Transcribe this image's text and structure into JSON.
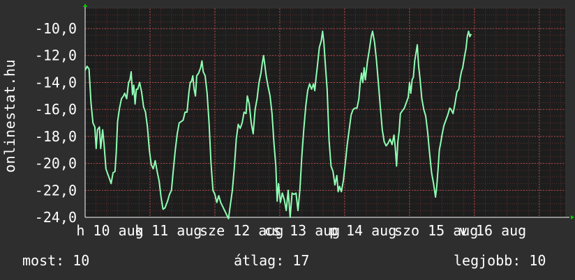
{
  "watermark": "onlinestat.hu",
  "stats": {
    "now_label": "most:",
    "now_value": "10",
    "avg_label": "átlag:",
    "avg_value": "17",
    "best_label": "legjobb:",
    "best_value": "10"
  },
  "colors": {
    "background": "#2e2e2e",
    "plot_background": "#1d1d1d",
    "line": "#8fffb4",
    "grid": "#b04a4a",
    "axis_arrow": "#00cc00",
    "text": "#ffffff"
  },
  "chart_data": {
    "type": "line",
    "title": "",
    "xlabel": "",
    "ylabel": "",
    "ylim": [
      -24,
      -8.5
    ],
    "xlim": [
      0,
      7.4
    ],
    "y_ticks": [
      -24,
      -22,
      -20,
      -18,
      -16,
      -14,
      -12,
      -10
    ],
    "y_tick_labels": [
      "-24,0",
      "-22,0",
      "-20,0",
      "-18,0",
      "-16,0",
      "-14,0",
      "-12,0",
      "-10,0"
    ],
    "x_tick_labels": [
      {
        "x": -0.05,
        "label": "h 10 aug"
      },
      {
        "x": 0.85,
        "label": "k 11 aug"
      },
      {
        "x": 1.85,
        "label": "sze 12 aug"
      },
      {
        "x": 2.85,
        "label": "cs 13 aug"
      },
      {
        "x": 3.85,
        "label": "p 14 aug"
      },
      {
        "x": 4.85,
        "label": "szo 15 aug"
      },
      {
        "x": 5.85,
        "label": "v 16 aug"
      }
    ],
    "grid": true,
    "series": [
      {
        "name": "",
        "points": [
          [
            0.0,
            -13.1
          ],
          [
            0.03,
            -12.8
          ],
          [
            0.06,
            -13.0
          ],
          [
            0.09,
            -15.5
          ],
          [
            0.12,
            -17.0
          ],
          [
            0.15,
            -17.3
          ],
          [
            0.17,
            -18.9
          ],
          [
            0.19,
            -17.5
          ],
          [
            0.22,
            -17.3
          ],
          [
            0.24,
            -18.9
          ],
          [
            0.27,
            -17.5
          ],
          [
            0.29,
            -18.5
          ],
          [
            0.32,
            -20.4
          ],
          [
            0.35,
            -20.8
          ],
          [
            0.38,
            -21.2
          ],
          [
            0.4,
            -21.5
          ],
          [
            0.43,
            -20.7
          ],
          [
            0.46,
            -20.6
          ],
          [
            0.48,
            -19.2
          ],
          [
            0.5,
            -16.9
          ],
          [
            0.53,
            -15.9
          ],
          [
            0.56,
            -15.2
          ],
          [
            0.59,
            -15.0
          ],
          [
            0.61,
            -14.8
          ],
          [
            0.64,
            -15.2
          ],
          [
            0.67,
            -14.0
          ],
          [
            0.69,
            -13.8
          ],
          [
            0.71,
            -13.2
          ],
          [
            0.73,
            -14.9
          ],
          [
            0.75,
            -14.2
          ],
          [
            0.77,
            -15.6
          ],
          [
            0.79,
            -14.5
          ],
          [
            0.81,
            -14.5
          ],
          [
            0.84,
            -14.0
          ],
          [
            0.87,
            -14.7
          ],
          [
            0.9,
            -15.8
          ],
          [
            0.93,
            -16.2
          ],
          [
            0.96,
            -17.3
          ],
          [
            0.99,
            -19.0
          ],
          [
            1.02,
            -20.1
          ],
          [
            1.05,
            -20.4
          ],
          [
            1.08,
            -19.8
          ],
          [
            1.11,
            -20.6
          ],
          [
            1.14,
            -21.3
          ],
          [
            1.17,
            -22.5
          ],
          [
            1.2,
            -23.4
          ],
          [
            1.23,
            -23.3
          ],
          [
            1.27,
            -22.8
          ],
          [
            1.3,
            -22.3
          ],
          [
            1.33,
            -22.0
          ],
          [
            1.36,
            -20.5
          ],
          [
            1.39,
            -19.0
          ],
          [
            1.42,
            -17.8
          ],
          [
            1.45,
            -17.0
          ],
          [
            1.48,
            -16.9
          ],
          [
            1.51,
            -16.8
          ],
          [
            1.54,
            -16.2
          ],
          [
            1.57,
            -16.2
          ],
          [
            1.6,
            -14.7
          ],
          [
            1.62,
            -14.0
          ],
          [
            1.64,
            -13.9
          ],
          [
            1.66,
            -13.5
          ],
          [
            1.68,
            -14.5
          ],
          [
            1.7,
            -15.0
          ],
          [
            1.72,
            -13.5
          ],
          [
            1.75,
            -13.3
          ],
          [
            1.78,
            -12.9
          ],
          [
            1.8,
            -12.4
          ],
          [
            1.82,
            -13.2
          ],
          [
            1.85,
            -13.5
          ],
          [
            1.88,
            -14.8
          ],
          [
            1.91,
            -17.0
          ],
          [
            1.94,
            -20.0
          ],
          [
            1.97,
            -22.0
          ],
          [
            2.0,
            -22.3
          ],
          [
            2.03,
            -22.9
          ],
          [
            2.06,
            -22.4
          ],
          [
            2.09,
            -22.9
          ],
          [
            2.12,
            -23.2
          ],
          [
            2.15,
            -23.5
          ],
          [
            2.18,
            -23.8
          ],
          [
            2.21,
            -24.1
          ],
          [
            2.24,
            -23.0
          ],
          [
            2.27,
            -22.0
          ],
          [
            2.3,
            -20.3
          ],
          [
            2.33,
            -18.2
          ],
          [
            2.36,
            -17.1
          ],
          [
            2.39,
            -17.4
          ],
          [
            2.42,
            -17.0
          ],
          [
            2.45,
            -16.2
          ],
          [
            2.48,
            -16.3
          ],
          [
            2.5,
            -15.0
          ],
          [
            2.53,
            -15.6
          ],
          [
            2.56,
            -17.0
          ],
          [
            2.59,
            -17.8
          ],
          [
            2.62,
            -16.0
          ],
          [
            2.65,
            -15.2
          ],
          [
            2.68,
            -14.0
          ],
          [
            2.71,
            -13.3
          ],
          [
            2.73,
            -12.6
          ],
          [
            2.75,
            -12.0
          ],
          [
            2.77,
            -12.7
          ],
          [
            2.79,
            -13.5
          ],
          [
            2.82,
            -14.3
          ],
          [
            2.85,
            -15.0
          ],
          [
            2.88,
            -16.3
          ],
          [
            2.91,
            -18.5
          ],
          [
            2.94,
            -20.2
          ],
          [
            2.96,
            -22.8
          ],
          [
            2.98,
            -21.5
          ],
          [
            3.01,
            -22.9
          ],
          [
            3.04,
            -22.2
          ],
          [
            3.07,
            -22.7
          ],
          [
            3.1,
            -23.5
          ],
          [
            3.13,
            -22.0
          ],
          [
            3.16,
            -24.0
          ],
          [
            3.19,
            -22.2
          ],
          [
            3.22,
            -22.3
          ],
          [
            3.25,
            -22.2
          ],
          [
            3.28,
            -23.5
          ],
          [
            3.31,
            -22.0
          ],
          [
            3.34,
            -19.5
          ],
          [
            3.37,
            -17.5
          ],
          [
            3.4,
            -15.8
          ],
          [
            3.43,
            -14.6
          ],
          [
            3.46,
            -14.1
          ],
          [
            3.49,
            -14.5
          ],
          [
            3.52,
            -14.1
          ],
          [
            3.54,
            -14.6
          ],
          [
            3.56,
            -13.6
          ],
          [
            3.58,
            -12.8
          ],
          [
            3.61,
            -11.4
          ],
          [
            3.64,
            -10.9
          ],
          [
            3.66,
            -10.2
          ],
          [
            3.68,
            -11.0
          ],
          [
            3.7,
            -12.5
          ],
          [
            3.73,
            -14.5
          ],
          [
            3.76,
            -18.3
          ],
          [
            3.79,
            -20.2
          ],
          [
            3.82,
            -20.6
          ],
          [
            3.85,
            -21.6
          ],
          [
            3.88,
            -20.9
          ],
          [
            3.9,
            -22.1
          ],
          [
            3.92,
            -21.7
          ],
          [
            3.95,
            -22.1
          ],
          [
            3.98,
            -21.3
          ],
          [
            4.01,
            -20.0
          ],
          [
            4.04,
            -18.6
          ],
          [
            4.07,
            -17.5
          ],
          [
            4.1,
            -16.4
          ],
          [
            4.13,
            -16.0
          ],
          [
            4.16,
            -15.9
          ],
          [
            4.19,
            -15.9
          ],
          [
            4.22,
            -15.2
          ],
          [
            4.24,
            -14.0
          ],
          [
            4.26,
            -13.3
          ],
          [
            4.28,
            -14.0
          ],
          [
            4.3,
            -12.9
          ],
          [
            4.32,
            -13.8
          ],
          [
            4.35,
            -12.5
          ],
          [
            4.38,
            -11.6
          ],
          [
            4.41,
            -10.6
          ],
          [
            4.43,
            -10.2
          ],
          [
            4.46,
            -11.0
          ],
          [
            4.49,
            -12.3
          ],
          [
            4.52,
            -14.0
          ],
          [
            4.55,
            -15.8
          ],
          [
            4.58,
            -17.5
          ],
          [
            4.61,
            -18.4
          ],
          [
            4.64,
            -18.7
          ],
          [
            4.67,
            -18.5
          ],
          [
            4.7,
            -18.2
          ],
          [
            4.73,
            -18.6
          ],
          [
            4.76,
            -17.9
          ],
          [
            4.78,
            -18.8
          ],
          [
            4.8,
            -20.2
          ],
          [
            4.82,
            -18.4
          ],
          [
            4.84,
            -17.6
          ],
          [
            4.86,
            -16.3
          ],
          [
            4.89,
            -16.1
          ],
          [
            4.92,
            -15.9
          ],
          [
            4.95,
            -15.5
          ],
          [
            4.98,
            -15.1
          ],
          [
            5.0,
            -14.0
          ],
          [
            5.02,
            -14.8
          ],
          [
            5.04,
            -13.8
          ],
          [
            5.06,
            -13.6
          ],
          [
            5.08,
            -12.4
          ],
          [
            5.1,
            -11.8
          ],
          [
            5.12,
            -11.2
          ],
          [
            5.14,
            -12.8
          ],
          [
            5.16,
            -13.6
          ],
          [
            5.19,
            -15.2
          ],
          [
            5.22,
            -16.0
          ],
          [
            5.25,
            -16.5
          ],
          [
            5.28,
            -17.7
          ],
          [
            5.31,
            -19.3
          ],
          [
            5.34,
            -20.7
          ],
          [
            5.37,
            -21.5
          ],
          [
            5.4,
            -22.5
          ],
          [
            5.42,
            -21.7
          ],
          [
            5.44,
            -20.4
          ],
          [
            5.46,
            -19.0
          ],
          [
            5.48,
            -18.5
          ],
          [
            5.5,
            -17.9
          ],
          [
            5.53,
            -17.2
          ],
          [
            5.56,
            -16.8
          ],
          [
            5.59,
            -16.4
          ],
          [
            5.62,
            -15.9
          ],
          [
            5.64,
            -16.0
          ],
          [
            5.67,
            -16.3
          ],
          [
            5.7,
            -15.6
          ],
          [
            5.73,
            -14.7
          ],
          [
            5.76,
            -14.5
          ],
          [
            5.78,
            -13.7
          ],
          [
            5.8,
            -13.2
          ],
          [
            5.82,
            -12.9
          ],
          [
            5.85,
            -12.0
          ],
          [
            5.87,
            -11.5
          ],
          [
            5.89,
            -10.6
          ],
          [
            5.91,
            -10.2
          ],
          [
            5.93,
            -10.6
          ],
          [
            5.95,
            -10.4
          ]
        ]
      }
    ]
  }
}
